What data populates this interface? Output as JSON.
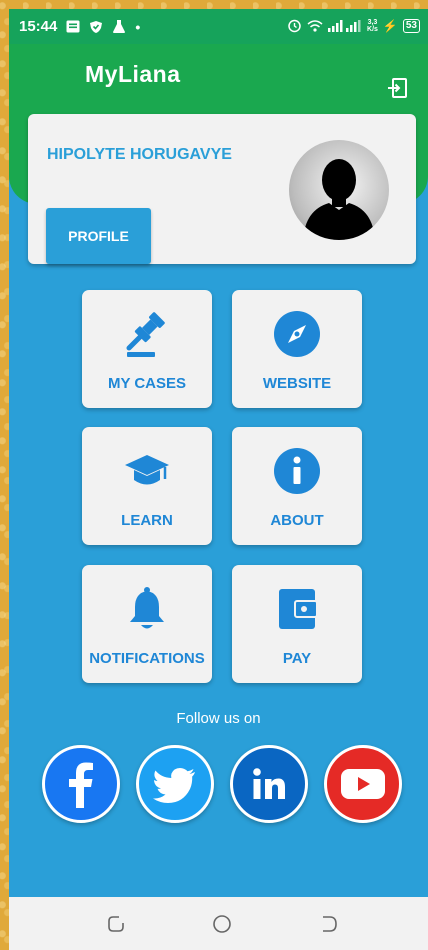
{
  "status_bar": {
    "time": "15:44",
    "speed": "3,3\nK/s",
    "battery": "53"
  },
  "header": {
    "app_title": "MyLiana",
    "logout_icon": "logout-icon"
  },
  "profile": {
    "name": "HIPOLYTE HORUGAVYE",
    "button_label": "PROFILE"
  },
  "tiles": [
    {
      "label": "MY CASES",
      "icon": "gavel-icon"
    },
    {
      "label": "WEBSITE",
      "icon": "compass-icon"
    },
    {
      "label": "LEARN",
      "icon": "graduation-cap-icon"
    },
    {
      "label": "ABOUT",
      "icon": "info-icon"
    },
    {
      "label": "NOTIFICATIONS",
      "icon": "bell-icon"
    },
    {
      "label": "PAY",
      "icon": "wallet-icon"
    }
  ],
  "social": {
    "follow_label": "Follow us on",
    "links": [
      {
        "name": "facebook",
        "color": "#1877f2"
      },
      {
        "name": "twitter",
        "color": "#1da1f2"
      },
      {
        "name": "linkedin",
        "color": "#0a66c2"
      },
      {
        "name": "youtube",
        "color": "#e52a26"
      }
    ]
  },
  "colors": {
    "accent_blue": "#2a9fd8",
    "header_green": "#1aa84f",
    "icon_blue": "#1f87d6"
  }
}
